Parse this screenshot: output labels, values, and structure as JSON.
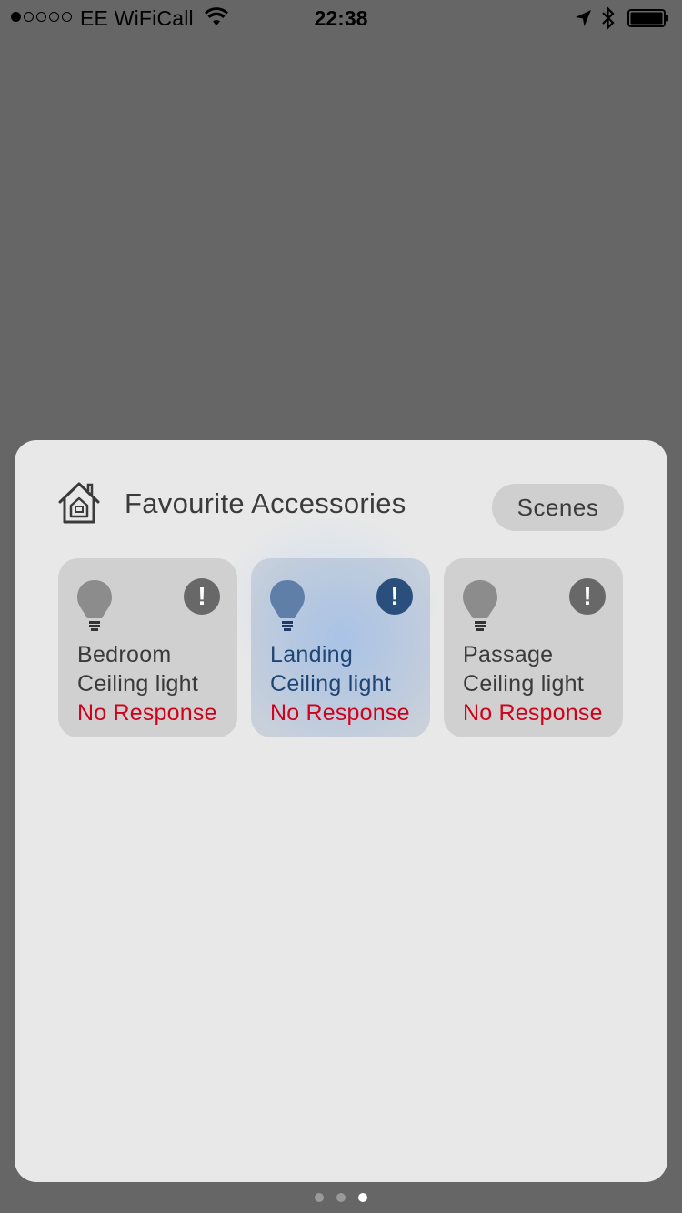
{
  "status_bar": {
    "signal_bars": [
      true,
      false,
      false,
      false,
      false
    ],
    "carrier": "EE WiFiCall",
    "time": "22:38",
    "icons": [
      "wifi-icon",
      "location-arrow-icon",
      "bluetooth-icon",
      "battery-icon"
    ]
  },
  "widget": {
    "title": "Favourite Accessories",
    "icon": "home-icon",
    "scenes_label": "Scenes",
    "tiles": [
      {
        "name_line1": "Bedroom",
        "name_line2": "Ceiling light",
        "status": "No Response",
        "icon": "lightbulb-icon",
        "alert_icon": "exclamation-icon",
        "highlighted": false
      },
      {
        "name_line1": "Landing",
        "name_line2": "Ceiling light",
        "status": "No Response",
        "icon": "lightbulb-icon",
        "alert_icon": "exclamation-icon",
        "highlighted": true
      },
      {
        "name_line1": "Passage",
        "name_line2": "Ceiling light",
        "status": "No Response",
        "icon": "lightbulb-icon",
        "alert_icon": "exclamation-icon",
        "highlighted": false
      }
    ],
    "alert_glyph": "!"
  },
  "page_indicator": {
    "count": 3,
    "active": 3
  },
  "colors": {
    "background": "#666666",
    "widget_bg": "#e8e8e8",
    "tile_bg": "#d0d0d0",
    "status_red": "#d0021b",
    "highlight_blue": "#1f4575"
  }
}
